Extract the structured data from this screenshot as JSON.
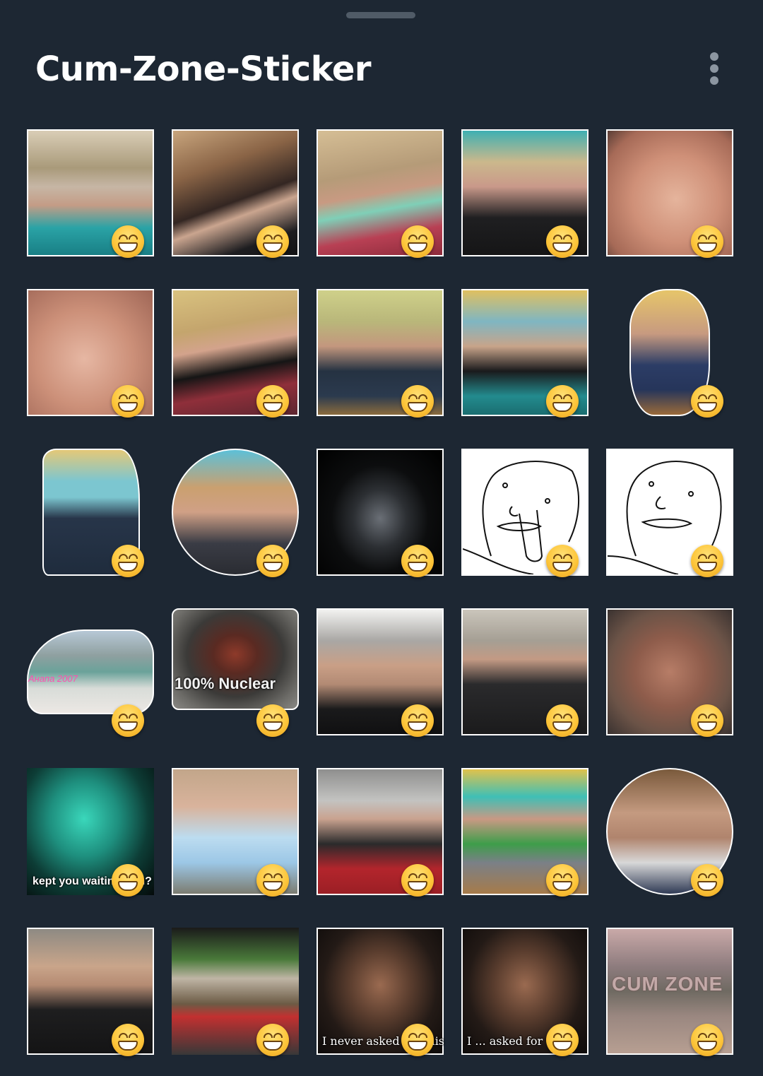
{
  "pack": {
    "title": "Cum-Zone-Sticker",
    "menu_icon": "more-vertical-icon"
  },
  "badge_emoji": "😁",
  "stickers": [
    {
      "caption": ""
    },
    {
      "caption": ""
    },
    {
      "caption": ""
    },
    {
      "caption": ""
    },
    {
      "caption": ""
    },
    {
      "caption": ""
    },
    {
      "caption": ""
    },
    {
      "caption": ""
    },
    {
      "caption": ""
    },
    {
      "caption": ""
    },
    {
      "caption": ""
    },
    {
      "caption": ""
    },
    {
      "caption": ""
    },
    {
      "caption": ""
    },
    {
      "caption": ""
    },
    {
      "caption": "Анапа 2007"
    },
    {
      "caption": "100% Nuclear"
    },
    {
      "caption": ""
    },
    {
      "caption": ""
    },
    {
      "caption": ""
    },
    {
      "caption": "kept you waiting huh?"
    },
    {
      "caption": ""
    },
    {
      "caption": ""
    },
    {
      "caption": ""
    },
    {
      "caption": ""
    },
    {
      "caption": ""
    },
    {
      "caption": ""
    },
    {
      "caption": "I never asked for this"
    },
    {
      "caption": "I ... asked for this"
    },
    {
      "caption": "CUM ZONE"
    }
  ],
  "colors": {
    "background": "#1d2733",
    "handle": "#505b67",
    "title": "#ffffff",
    "menu_dots": "#8c96a1"
  }
}
